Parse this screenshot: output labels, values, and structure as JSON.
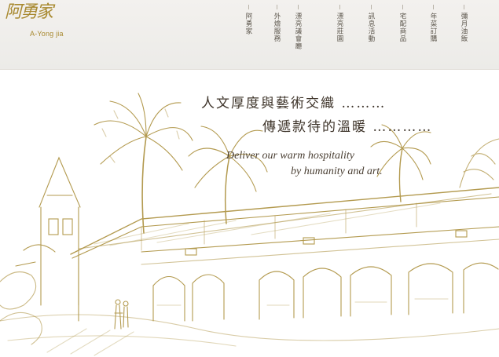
{
  "logo": {
    "cn": "阿勇家",
    "en": "A-Yong jia"
  },
  "nav": [
    {
      "label": "阿勇家"
    },
    {
      "label": "外燴服務"
    },
    {
      "label": "漂亮議會廳"
    },
    {
      "label": "漂亮莊園"
    },
    {
      "label": "訊息活動"
    },
    {
      "label": "宅配商品"
    },
    {
      "label": "年菜訂購"
    },
    {
      "label": "彌月油飯"
    }
  ],
  "hero": {
    "line1": "人文厚度與藝術交織 ………",
    "line2": "傳遞款待的溫暖 …………",
    "en1": "Deliver our warm hospitality",
    "en2": "by humanity and art."
  },
  "colors": {
    "gold": "#a8892f",
    "sketch": "#b39a4f",
    "text": "#3e342a"
  }
}
